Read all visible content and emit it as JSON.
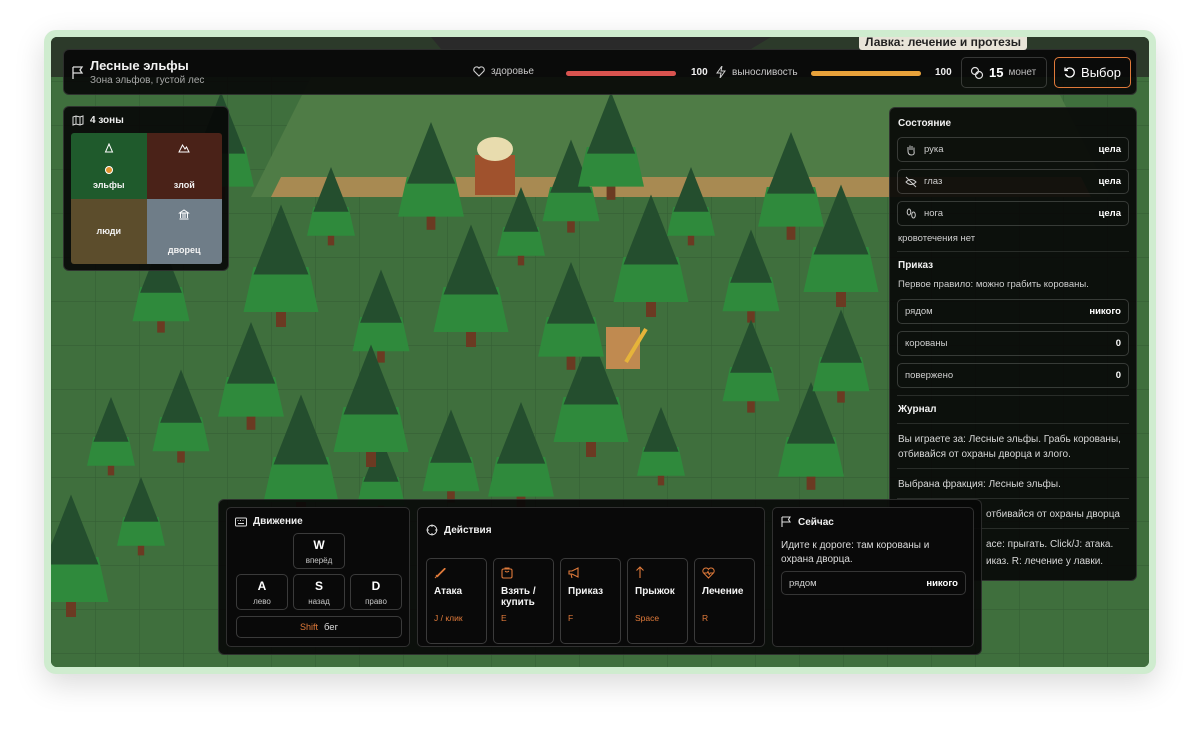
{
  "header": {
    "title": "Лесные эльфы",
    "subtitle": "Зона эльфов, густой лес",
    "health_label": "здоровье",
    "health_value": "100",
    "stamina_label": "выносливость",
    "stamina_value": "100",
    "health_fraction": 1.0,
    "stamina_fraction": 1.0,
    "coins_value": "15",
    "coins_label": "монет",
    "choose_label": "Выбор",
    "shop_sign": "Лавка: лечение и протезы"
  },
  "zones": {
    "title": "4 зоны",
    "items": [
      {
        "label": "эльфы",
        "color": "#1f5a2c",
        "icon": "tree-icon",
        "current": true
      },
      {
        "label": "злой",
        "color": "#4a2218",
        "icon": "mountain-icon",
        "current": false
      },
      {
        "label": "люди",
        "color": "#5c4d2c",
        "icon": "",
        "current": false
      },
      {
        "label": "дворец",
        "color": "#6f7d88",
        "icon": "palace-icon",
        "current": false
      }
    ]
  },
  "status": {
    "title": "Состояние",
    "rows": [
      {
        "icon": "hand-icon",
        "label": "рука",
        "value": "цела"
      },
      {
        "icon": "eye-off-icon",
        "label": "глаз",
        "value": "цела"
      },
      {
        "icon": "footprints-icon",
        "label": "нога",
        "value": "цела"
      }
    ],
    "bleeding": "кровотечения нет"
  },
  "order": {
    "title": "Приказ",
    "rule": "Первое правило: можно грабить корованы.",
    "rows": [
      {
        "label": "рядом",
        "value": "никого"
      },
      {
        "label": "корованы",
        "value": "0"
      },
      {
        "label": "повержено",
        "value": "0"
      }
    ]
  },
  "journal": {
    "title": "Журнал",
    "entries": [
      "Вы играете за: Лесные эльфы. Грабь корованы, отбивайся от охраны дворца и злого.",
      "Выбрана фракция: Лесные эльфы.",
      "отбивайся от охраны дворца",
      "ace: прыгать. Click/J: атака.",
      "иказ. R: лечение у лавки."
    ]
  },
  "movement": {
    "title": "Движение",
    "keys": [
      {
        "key": "W",
        "desc": "вперёд"
      },
      {
        "key": "A",
        "desc": "лево"
      },
      {
        "key": "S",
        "desc": "назад"
      },
      {
        "key": "D",
        "desc": "право"
      }
    ],
    "run_key": "Shift",
    "run_desc": "бег"
  },
  "actions": {
    "title": "Действия",
    "items": [
      {
        "icon": "sword-icon",
        "name": "Атака",
        "keys": "J / клик"
      },
      {
        "icon": "bag-icon",
        "name": "Взять / купить",
        "keys": "E"
      },
      {
        "icon": "megaphone-icon",
        "name": "Приказ",
        "keys": "F"
      },
      {
        "icon": "arrow-up-icon",
        "name": "Прыжок",
        "keys": "Space"
      },
      {
        "icon": "heart-pulse-icon",
        "name": "Лечение",
        "keys": "R"
      }
    ]
  },
  "now": {
    "title": "Сейчас",
    "text": "Идите к дороге: там корованы и охрана дворца.",
    "nearby_label": "рядом",
    "nearby_value": "никого"
  },
  "colors": {
    "accent": "#e07a3a",
    "health": "#d9534f",
    "stamina": "#e8a23a"
  }
}
